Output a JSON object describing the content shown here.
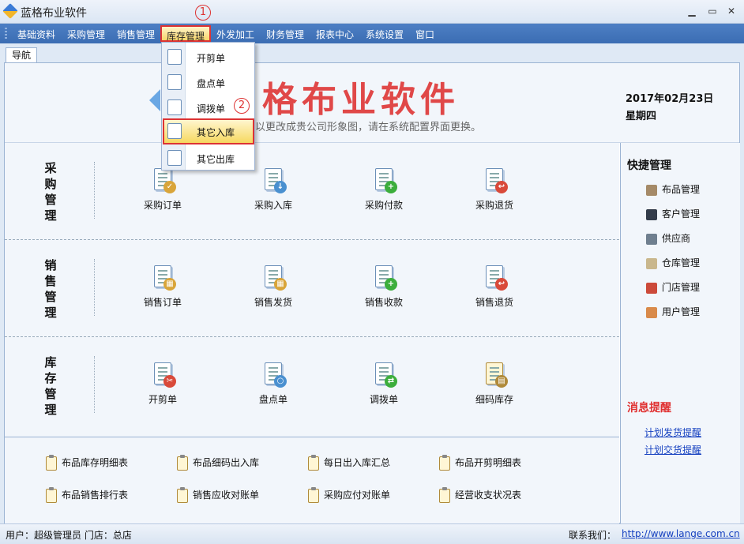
{
  "window": {
    "title": "蓝格布业软件",
    "min_symbol": "▁",
    "max_symbol": "▭",
    "close_symbol": "✕"
  },
  "menu": {
    "items": [
      "基础资料",
      "采购管理",
      "销售管理",
      "库存管理",
      "外发加工",
      "财务管理",
      "报表中心",
      "系统设置",
      "窗口"
    ],
    "active": "库存管理"
  },
  "callouts": {
    "one": "1",
    "two": "2"
  },
  "tabs": {
    "nav": "导航"
  },
  "dropdown": {
    "items": [
      {
        "label": "开剪单",
        "icon": "scissors-doc-icon"
      },
      {
        "label": "盘点单",
        "icon": "magnifier-doc-icon"
      },
      {
        "label": "调拨单",
        "icon": "transfer-doc-icon"
      },
      {
        "label": "其它入库",
        "icon": "inbound-doc-icon"
      },
      {
        "label": "其它出库",
        "icon": "outbound-doc-icon"
      }
    ],
    "highlighted": "其它入库"
  },
  "banner": {
    "title": "格布业软件",
    "subtitle": "以更改成贵公司形象图，请在系统配置界面更换。",
    "date": "2017年02月23日",
    "weekday": "星期四"
  },
  "sections": [
    {
      "title": "采购管理",
      "modules": [
        {
          "label": "采购订单",
          "icon": "purchase-order-icon",
          "badge_color": "#d9a53a"
        },
        {
          "label": "采购入库",
          "icon": "purchase-inbound-icon",
          "badge_color": "#4a90d0"
        },
        {
          "label": "采购付款",
          "icon": "purchase-payment-icon",
          "badge_color": "#3cae3c"
        },
        {
          "label": "采购退货",
          "icon": "purchase-return-icon",
          "badge_color": "#d94a3a"
        }
      ]
    },
    {
      "title": "销售管理",
      "modules": [
        {
          "label": "销售订单",
          "icon": "sales-order-icon",
          "badge_color": "#d9a53a"
        },
        {
          "label": "销售发货",
          "icon": "sales-delivery-icon",
          "badge_color": "#d9a53a"
        },
        {
          "label": "销售收款",
          "icon": "sales-receipt-icon",
          "badge_color": "#3cae3c"
        },
        {
          "label": "销售退货",
          "icon": "sales-return-icon",
          "badge_color": "#d94a3a"
        }
      ]
    },
    {
      "title": "库存管理",
      "modules": [
        {
          "label": "开剪单",
          "icon": "cut-order-icon",
          "badge_color": "#d94a3a"
        },
        {
          "label": "盘点单",
          "icon": "stocktake-icon",
          "badge_color": "#4a90d0"
        },
        {
          "label": "调拨单",
          "icon": "transfer-icon",
          "badge_color": "#3cae3c"
        },
        {
          "label": "细码库存",
          "icon": "detail-stock-icon",
          "badge_color": "#b08a3a"
        }
      ]
    }
  ],
  "reports": [
    "布品库存明细表",
    "布品细码出入库",
    "每日出入库汇总",
    "布品开剪明细表",
    "布品销售排行表",
    "销售应收对账单",
    "采购应付对账单",
    "经营收支状况表"
  ],
  "quick": {
    "title": "快捷管理",
    "items": [
      {
        "label": "布品管理",
        "icon": "fabric-icon",
        "color": "#a58a68"
      },
      {
        "label": "客户管理",
        "icon": "customer-icon",
        "color": "#333c4a"
      },
      {
        "label": "供应商",
        "icon": "supplier-icon",
        "color": "#6f7f8f"
      },
      {
        "label": "仓库管理",
        "icon": "warehouse-icon",
        "color": "#c9b78d"
      },
      {
        "label": "门店管理",
        "icon": "store-icon",
        "color": "#cc4a3a"
      },
      {
        "label": "用户管理",
        "icon": "user-icon",
        "color": "#d98a4a"
      }
    ]
  },
  "messages": {
    "title": "消息提醒",
    "links": [
      "计划发货提醒",
      "计划交货提醒"
    ]
  },
  "status": {
    "user": "用户：超级管理员  门店：总店",
    "contact_label": "联系我们：",
    "url": "http://www.lange.com.cn"
  }
}
